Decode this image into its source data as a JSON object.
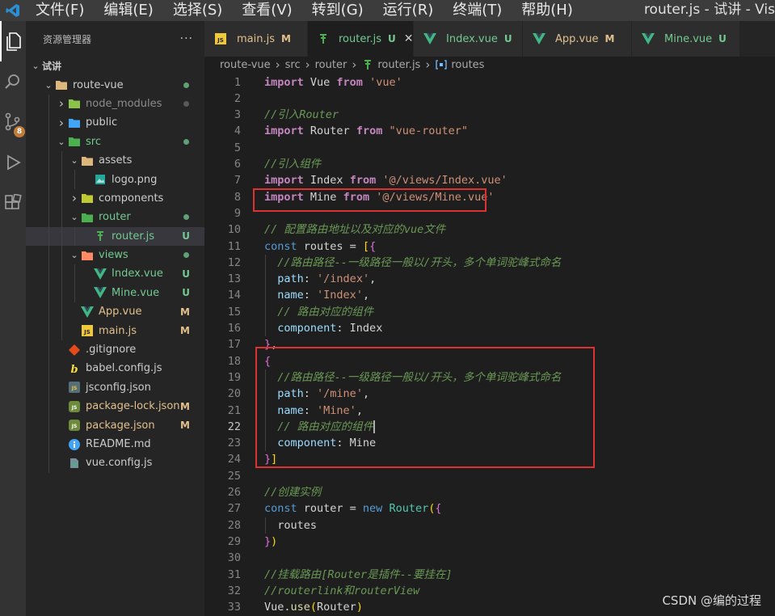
{
  "titlebar": {
    "menu": [
      "文件(F)",
      "编辑(E)",
      "选择(S)",
      "查看(V)",
      "转到(G)",
      "运行(R)",
      "终端(T)",
      "帮助(H)"
    ],
    "window_title": "router.js - 试讲 - Vis"
  },
  "activity": {
    "scm_badge": "8"
  },
  "sidebar": {
    "title": "资源管理器",
    "more": "···",
    "workspace": "试讲",
    "tree": [
      {
        "label": "route-vue",
        "status": ""
      },
      {
        "label": "node_modules",
        "status": ""
      },
      {
        "label": "public",
        "status": ""
      },
      {
        "label": "src",
        "status": ""
      },
      {
        "label": "assets",
        "status": ""
      },
      {
        "label": "logo.png",
        "status": ""
      },
      {
        "label": "components",
        "status": ""
      },
      {
        "label": "router",
        "status": ""
      },
      {
        "label": "router.js",
        "status": "U"
      },
      {
        "label": "views",
        "status": ""
      },
      {
        "label": "Index.vue",
        "status": "U"
      },
      {
        "label": "Mine.vue",
        "status": "U"
      },
      {
        "label": "App.vue",
        "status": "M"
      },
      {
        "label": "main.js",
        "status": "M"
      },
      {
        "label": ".gitignore",
        "status": ""
      },
      {
        "label": "babel.config.js",
        "status": ""
      },
      {
        "label": "jsconfig.json",
        "status": ""
      },
      {
        "label": "package-lock.json",
        "status": "M"
      },
      {
        "label": "package.json",
        "status": "M"
      },
      {
        "label": "README.md",
        "status": ""
      },
      {
        "label": "vue.config.js",
        "status": ""
      }
    ]
  },
  "tabs": [
    {
      "label": "main.js",
      "status": "M"
    },
    {
      "label": "router.js",
      "status": "U",
      "close": "✕"
    },
    {
      "label": "Index.vue",
      "status": "U"
    },
    {
      "label": "App.vue",
      "status": "M"
    },
    {
      "label": "Mine.vue",
      "status": "U"
    }
  ],
  "breadcrumb": [
    "route-vue",
    "src",
    "router",
    "router.js",
    "routes"
  ],
  "editor": {
    "line_numbers": [
      "1",
      "2",
      "3",
      "4",
      "5",
      "6",
      "7",
      "8",
      "9",
      "10",
      "11",
      "12",
      "13",
      "14",
      "15",
      "16",
      "17",
      "18",
      "19",
      "20",
      "21",
      "22",
      "23",
      "24",
      "25",
      "26",
      "27",
      "28",
      "29",
      "30",
      "31",
      "32",
      "33"
    ],
    "current_line": "22",
    "lines": [
      [
        [
          "kw",
          "import"
        ],
        [
          "id",
          " Vue "
        ],
        [
          "kw",
          "from"
        ],
        [
          "id",
          " "
        ],
        [
          "str",
          "'vue'"
        ]
      ],
      [],
      [
        [
          "cm",
          "//引入Router"
        ]
      ],
      [
        [
          "kw",
          "import"
        ],
        [
          "id",
          " Router "
        ],
        [
          "kw",
          "from"
        ],
        [
          "id",
          " "
        ],
        [
          "str",
          "\"vue-router\""
        ]
      ],
      [],
      [
        [
          "cm",
          "//引入组件"
        ]
      ],
      [
        [
          "kw",
          "import"
        ],
        [
          "id",
          " Index "
        ],
        [
          "kw",
          "from"
        ],
        [
          "id",
          " "
        ],
        [
          "str",
          "'@/views/Index.vue'"
        ]
      ],
      [
        [
          "kw",
          "import"
        ],
        [
          "id",
          " Mine "
        ],
        [
          "kw",
          "from"
        ],
        [
          "id",
          " "
        ],
        [
          "str",
          "'@/views/Mine.vue'"
        ]
      ],
      [],
      [
        [
          "cm",
          "// 配置路由地址以及对应的vue文件"
        ]
      ],
      [
        [
          "kw2",
          "const"
        ],
        [
          "id",
          " routes = "
        ],
        [
          "br1",
          "["
        ],
        [
          "br2",
          "{"
        ]
      ],
      [
        [
          "id",
          "  "
        ],
        [
          "cm",
          "//路由路径--一级路径一般以/开头，多个单词驼峰式命名"
        ]
      ],
      [
        [
          "id",
          "  "
        ],
        [
          "var",
          "path"
        ],
        [
          "id",
          ": "
        ],
        [
          "str",
          "'/index'"
        ],
        [
          "id",
          ","
        ]
      ],
      [
        [
          "id",
          "  "
        ],
        [
          "var",
          "name"
        ],
        [
          "id",
          ": "
        ],
        [
          "str",
          "'Index'"
        ],
        [
          "id",
          ","
        ]
      ],
      [
        [
          "id",
          "  "
        ],
        [
          "cm",
          "// 路由对应的组件"
        ]
      ],
      [
        [
          "id",
          "  "
        ],
        [
          "var",
          "component"
        ],
        [
          "id",
          ": Index"
        ]
      ],
      [
        [
          "br2",
          "}"
        ],
        [
          "id",
          ","
        ]
      ],
      [
        [
          "br2",
          "{"
        ]
      ],
      [
        [
          "id",
          "  "
        ],
        [
          "cm",
          "//路由路径--一级路径一般以/开头，多个单词驼峰式命名"
        ]
      ],
      [
        [
          "id",
          "  "
        ],
        [
          "var",
          "path"
        ],
        [
          "id",
          ": "
        ],
        [
          "str",
          "'/mine'"
        ],
        [
          "id",
          ","
        ]
      ],
      [
        [
          "id",
          "  "
        ],
        [
          "var",
          "name"
        ],
        [
          "id",
          ": "
        ],
        [
          "str",
          "'Mine'"
        ],
        [
          "id",
          ","
        ]
      ],
      [
        [
          "id",
          "  "
        ],
        [
          "cm",
          "// 路由对应的组件"
        ]
      ],
      [
        [
          "id",
          "  "
        ],
        [
          "var",
          "component"
        ],
        [
          "id",
          ": Mine"
        ]
      ],
      [
        [
          "br2",
          "}"
        ],
        [
          "br1",
          "]"
        ]
      ],
      [],
      [
        [
          "cm",
          "//创建实例"
        ]
      ],
      [
        [
          "kw2",
          "const"
        ],
        [
          "id",
          " router = "
        ],
        [
          "kw2",
          "new"
        ],
        [
          "id",
          " "
        ],
        [
          "cls",
          "Router"
        ],
        [
          "br1",
          "("
        ],
        [
          "br2",
          "{"
        ]
      ],
      [
        [
          "id",
          "  routes"
        ]
      ],
      [
        [
          "br2",
          "}"
        ],
        [
          "br1",
          ")"
        ]
      ],
      [],
      [
        [
          "cm",
          "//挂载路由[Router是插件--要挂在]"
        ]
      ],
      [
        [
          "cm",
          "//routerlink和routerView"
        ]
      ],
      [
        [
          "id",
          "Vue."
        ],
        [
          "fn",
          "use"
        ],
        [
          "br1",
          "("
        ],
        [
          "id",
          "Router"
        ],
        [
          "br1",
          ")"
        ]
      ]
    ]
  },
  "watermark": "CSDN @编的过程",
  "colors": {
    "highlight_box": "#e03131",
    "untracked": "#73c991",
    "modified": "#e2c08d"
  }
}
